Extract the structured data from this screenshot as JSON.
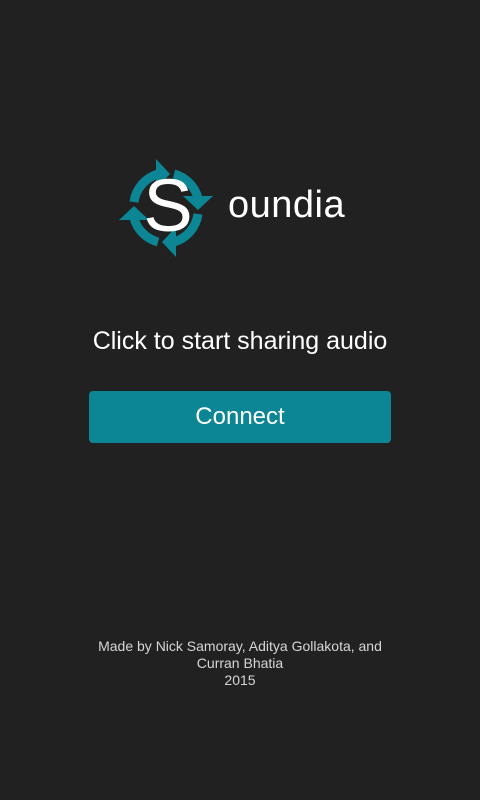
{
  "colors": {
    "background": "#212121",
    "accent": "#0c8594",
    "text": "#ffffff",
    "credits_text": "#d6d6d6"
  },
  "logo": {
    "letter": "S",
    "wordmark": "oundia",
    "icon": "circular-sync-arrows-icon"
  },
  "main": {
    "prompt": "Click to start sharing audio",
    "connect_label": "Connect"
  },
  "credits": {
    "line1": "Made by Nick Samoray, Aditya Gollakota, and",
    "line2": "Curran Bhatia",
    "year": "2015"
  }
}
